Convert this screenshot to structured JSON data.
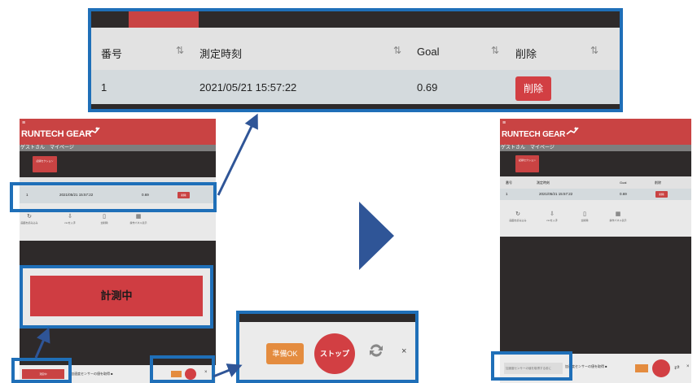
{
  "app": {
    "brand": "RUNTECH GEAR",
    "hamburger": "≡",
    "subnav": "ゲストさん　マイページ",
    "tab_label": "記録セクション"
  },
  "table": {
    "headers": [
      "番号",
      "測定時刻",
      "Goal",
      "削除"
    ],
    "sort_icon": "⇅",
    "rows": [
      {
        "no": "1",
        "time": "2021/05/21 15:57:22",
        "goal": "0.69",
        "delete": "削除"
      }
    ]
  },
  "icon_bar": [
    {
      "icon": "refresh-icon",
      "glyph": "↻",
      "label": "画面を読み込み"
    },
    {
      "icon": "download-icon",
      "glyph": "⇩",
      "label": "csvを入手"
    },
    {
      "icon": "trash-icon",
      "glyph": "▯",
      "label": "全削除"
    },
    {
      "icon": "calendar-icon",
      "glyph": "▦",
      "label": "操作パネル表示"
    }
  ],
  "measuring": {
    "label": "計測中"
  },
  "controls": {
    "ready_label": "準備OK",
    "stop_label": "ストップ",
    "swap_icon": "swap-icon",
    "close_label": "×"
  },
  "bottom": {
    "red_tab_label": "測定中",
    "status_text": "加速度センサーの値を取得 ■",
    "right_input_placeholder": "加速度センサーの値を取得する前に"
  },
  "colors": {
    "brand_red": "#c94343",
    "highlight_blue": "#1f6fb8",
    "dark_bg": "#2e2a2a",
    "ready_orange": "#e48c3f",
    "arrow_navy": "#2f5597"
  }
}
